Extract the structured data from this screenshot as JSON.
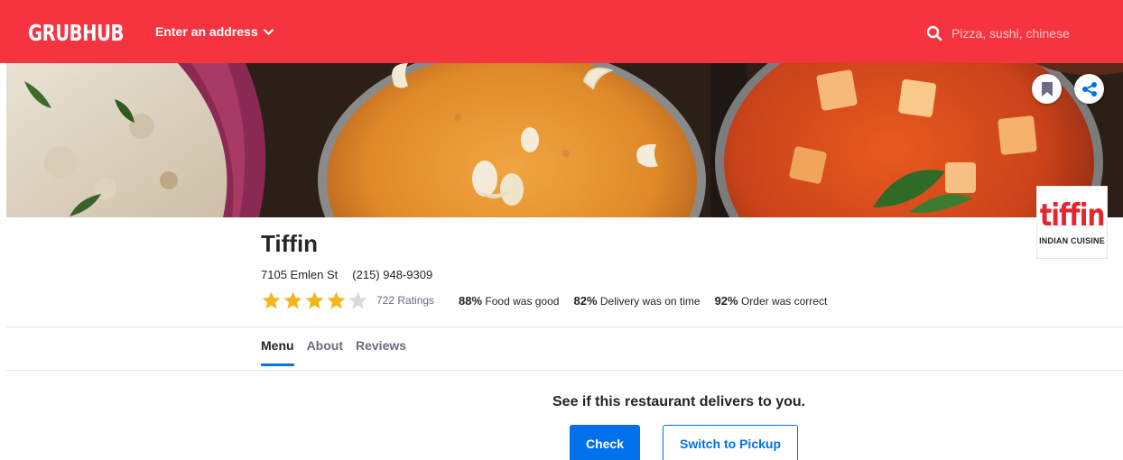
{
  "header": {
    "logo": "GRUBHUB",
    "address_label": "Enter an address",
    "search_placeholder": "Pizza, sushi, chinese"
  },
  "restaurant": {
    "name": "Tiffin",
    "address": "7105 Emlen St",
    "phone": "(215) 948-9309",
    "rating_stars": 4,
    "rating_max": 5,
    "ratings_count": "722 Ratings",
    "logo_word": "tiffin",
    "logo_sub": "INDIAN CUISINE",
    "stats": [
      {
        "percent": "88%",
        "label": "Food was good"
      },
      {
        "percent": "82%",
        "label": "Delivery was on time"
      },
      {
        "percent": "92%",
        "label": "Order was correct"
      }
    ]
  },
  "tabs": [
    {
      "label": "Menu",
      "active": true
    },
    {
      "label": "About",
      "active": false
    },
    {
      "label": "Reviews",
      "active": false
    }
  ],
  "delivery": {
    "prompt": "See if this restaurant delivers to you.",
    "check_label": "Check",
    "pickup_label": "Switch to Pickup"
  },
  "colors": {
    "brand_red": "#f63440",
    "accent_blue": "#0070eb",
    "star_gold": "#f3b61b",
    "logo_red": "#e4262f"
  },
  "icons": [
    "chevron-down-icon",
    "search-icon",
    "bookmark-icon",
    "share-icon",
    "star-icon"
  ]
}
